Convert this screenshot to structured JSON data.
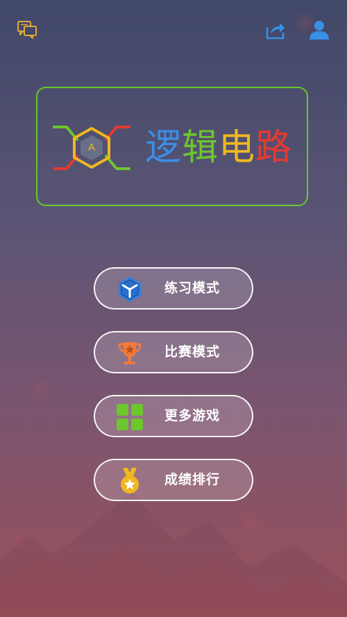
{
  "header": {
    "feedback_icon": "chat-bubbles-icon",
    "share_icon": "share-icon",
    "profile_icon": "user-icon"
  },
  "logo": {
    "badge_letter": "A"
  },
  "title": {
    "chars": [
      "逻",
      "辑",
      "电",
      "路"
    ],
    "colors": [
      "#3a8fe6",
      "#6cc62d",
      "#f0b820",
      "#e6392f"
    ]
  },
  "menu": [
    {
      "label": "练习模式",
      "icon": "cube-icon",
      "icon_color": "#2f7fe0"
    },
    {
      "label": "比赛模式",
      "icon": "trophy-icon",
      "icon_color": "#f07a3a"
    },
    {
      "label": "更多游戏",
      "icon": "grid-icon",
      "icon_color": "#6cc62d"
    },
    {
      "label": "成绩排行",
      "icon": "medal-icon",
      "icon_color": "#f0b820"
    }
  ],
  "colors": {
    "accent_green": "#6cc62d",
    "header_icon_gold": "#e0a93a",
    "header_icon_blue": "#3a8fe6"
  }
}
